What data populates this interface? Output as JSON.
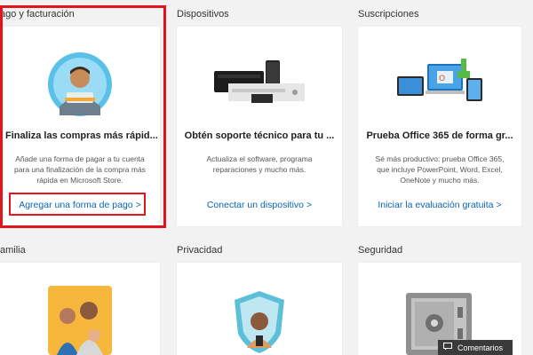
{
  "sections": {
    "payment": "ago y facturación",
    "devices": "Dispositivos",
    "subscriptions": "Suscripciones",
    "family": "amilia",
    "privacy": "Privacidad",
    "security": "Seguridad"
  },
  "cards": {
    "payment": {
      "title": "Finaliza las compras más rápid...",
      "desc_lines": [
        "Añade una forma de pagar a tu cuenta",
        "para una finalización de la compra más",
        "rápida en Microsoft Store."
      ],
      "link": "Agregar una forma de pago",
      "chevron": ">"
    },
    "devices": {
      "title": "Obtén soporte técnico para tu ...",
      "desc_lines": [
        "Actualiza el software, programa",
        "reparaciones y mucho más."
      ],
      "link": "Conectar un dispositivo",
      "chevron": ">"
    },
    "subscriptions": {
      "title": "Prueba Office 365 de forma gr...",
      "desc_lines": [
        "Sé más productivo: prueba Office 365,",
        "que incluye PowerPoint, Word, Excel,",
        "OneNote y mucho más."
      ],
      "link": "Iniciar la evaluación gratuita",
      "chevron": ">"
    }
  },
  "feedback": {
    "label": "Comentarios"
  },
  "colors": {
    "link": "#0a64b4",
    "highlight": "#e4141f",
    "background": "#f2f2f2"
  }
}
